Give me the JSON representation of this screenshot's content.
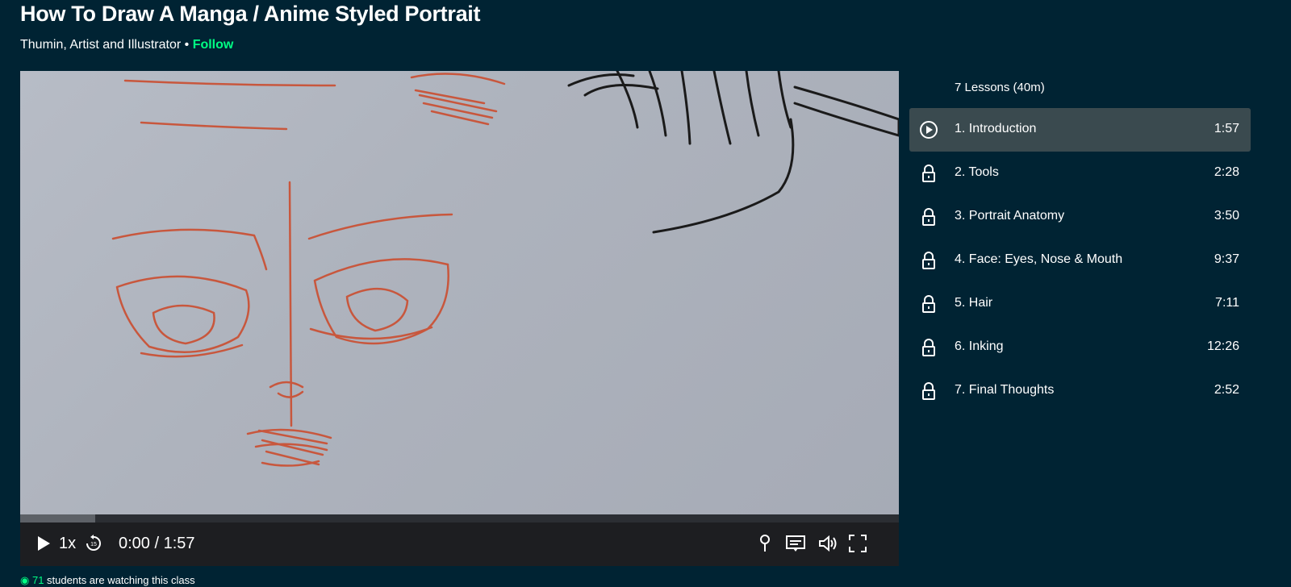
{
  "header": {
    "title": "How To Draw A Manga / Anime Styled Portrait",
    "author": "Thumin, Artist and Illustrator",
    "separator": " • ",
    "follow_label": "Follow"
  },
  "player": {
    "speed": "1x",
    "time": "0:00 / 1:57",
    "progress": 0.085,
    "icons": [
      "play-icon",
      "rewind-15-icon",
      "pin-icon",
      "captions-icon",
      "volume-icon",
      "fullscreen-icon"
    ]
  },
  "lessons": {
    "summary": "7 Lessons (40m)",
    "items": [
      {
        "title": "1. Introduction",
        "duration": "1:57",
        "state": "playing"
      },
      {
        "title": "2. Tools",
        "duration": "2:28",
        "state": "locked"
      },
      {
        "title": "3. Portrait Anatomy",
        "duration": "3:50",
        "state": "locked"
      },
      {
        "title": "4. Face: Eyes, Nose & Mouth",
        "duration": "9:37",
        "state": "locked"
      },
      {
        "title": "5. Hair",
        "duration": "7:11",
        "state": "locked"
      },
      {
        "title": "6. Inking",
        "duration": "12:26",
        "state": "locked"
      },
      {
        "title": "7. Final Thoughts",
        "duration": "2:52",
        "state": "locked"
      }
    ]
  },
  "footer": {
    "watching_count": "71",
    "watching_text": " students are watching this class"
  },
  "colors": {
    "background": "#002333",
    "accent": "#00ff84",
    "active_lesson": "#3a4a4f",
    "player_bar": "#1d1e21"
  }
}
